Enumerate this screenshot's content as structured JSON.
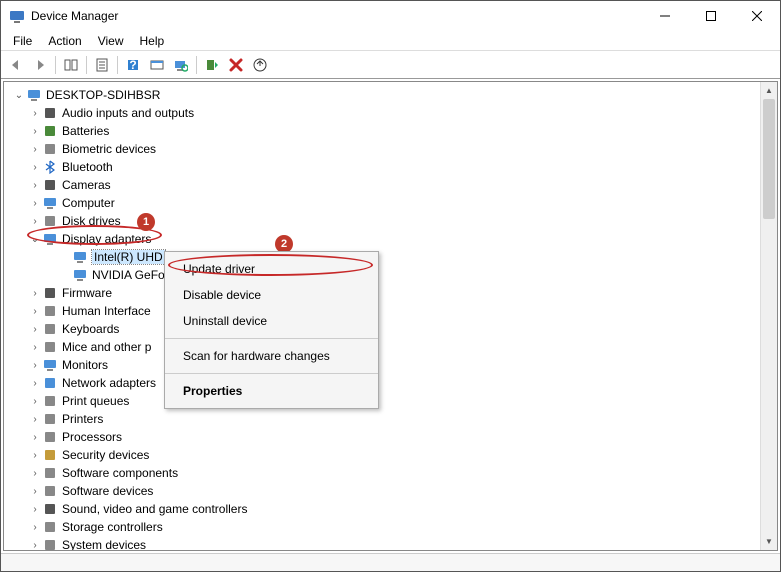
{
  "title": "Device Manager",
  "menu": {
    "file": "File",
    "action": "Action",
    "view": "View",
    "help": "Help"
  },
  "root": "DESKTOP-SDIHBSR",
  "categories": [
    {
      "label": "Audio inputs and outputs",
      "icon": "speaker"
    },
    {
      "label": "Batteries",
      "icon": "battery"
    },
    {
      "label": "Biometric devices",
      "icon": "fingerprint"
    },
    {
      "label": "Bluetooth",
      "icon": "bluetooth"
    },
    {
      "label": "Cameras",
      "icon": "camera"
    },
    {
      "label": "Computer",
      "icon": "computer"
    },
    {
      "label": "Disk drives",
      "icon": "disk"
    },
    {
      "label": "Display adapters",
      "icon": "display",
      "open": true,
      "devices": [
        {
          "label": "Intel(R) UHD",
          "icon": "display",
          "selected": true
        },
        {
          "label": "NVIDIA GeFo",
          "icon": "display"
        }
      ]
    },
    {
      "label": "Firmware",
      "icon": "firmware"
    },
    {
      "label": "Human Interface",
      "icon": "hid"
    },
    {
      "label": "Keyboards",
      "icon": "keyboard"
    },
    {
      "label": "Mice and other p",
      "icon": "mouse"
    },
    {
      "label": "Monitors",
      "icon": "monitor"
    },
    {
      "label": "Network adapters",
      "icon": "network"
    },
    {
      "label": "Print queues",
      "icon": "printer"
    },
    {
      "label": "Printers",
      "icon": "printer"
    },
    {
      "label": "Processors",
      "icon": "cpu"
    },
    {
      "label": "Security devices",
      "icon": "security"
    },
    {
      "label": "Software components",
      "icon": "software"
    },
    {
      "label": "Software devices",
      "icon": "software"
    },
    {
      "label": "Sound, video and game controllers",
      "icon": "sound"
    },
    {
      "label": "Storage controllers",
      "icon": "storage"
    },
    {
      "label": "System devices",
      "icon": "system"
    }
  ],
  "context_menu": {
    "update": "Update driver",
    "disable": "Disable device",
    "uninstall": "Uninstall device",
    "scan": "Scan for hardware changes",
    "properties": "Properties"
  },
  "annotations": {
    "badge1": "1",
    "badge2": "2"
  }
}
